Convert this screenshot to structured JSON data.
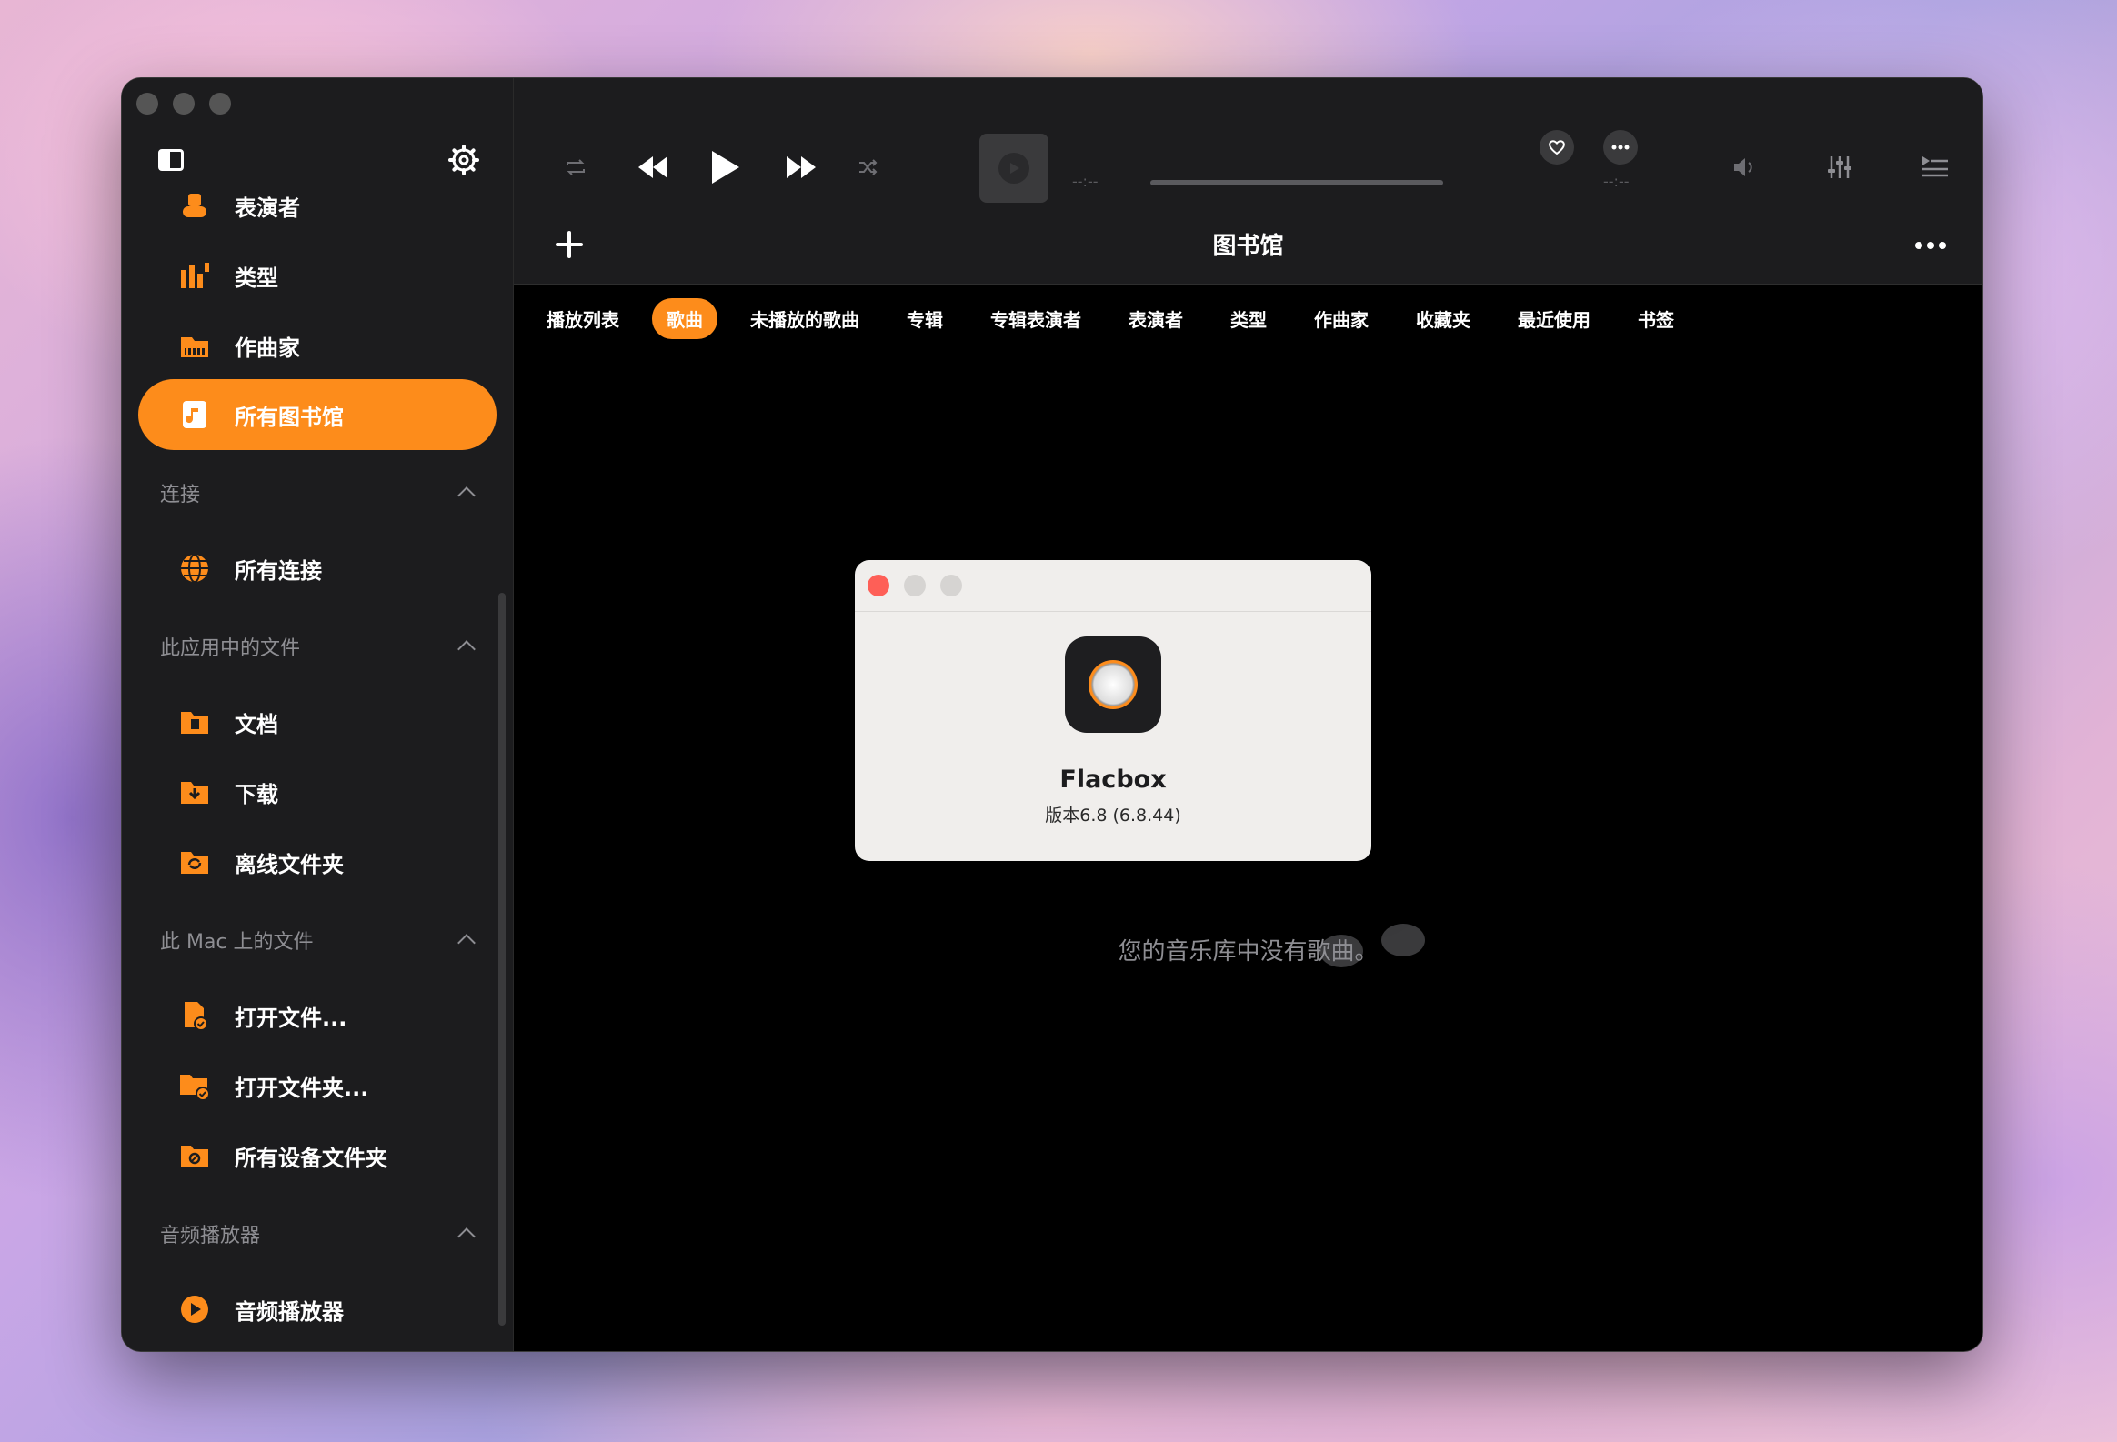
{
  "sidebar": {
    "items_top": [
      {
        "label": "表演者",
        "icon": "performer-icon"
      },
      {
        "label": "类型",
        "icon": "genre-icon"
      },
      {
        "label": "作曲家",
        "icon": "composer-icon"
      },
      {
        "label": "所有图书馆",
        "icon": "library-icon",
        "active": true
      }
    ],
    "sections": {
      "connections": {
        "title": "连接",
        "items": [
          {
            "label": "所有连接",
            "icon": "globe-icon"
          }
        ]
      },
      "app_files": {
        "title": "此应用中的文件",
        "items": [
          {
            "label": "文档",
            "icon": "documents-folder-icon"
          },
          {
            "label": "下载",
            "icon": "downloads-folder-icon"
          },
          {
            "label": "离线文件夹",
            "icon": "offline-folder-icon"
          }
        ]
      },
      "mac_files": {
        "title": "此 Mac 上的文件",
        "items": [
          {
            "label": "打开文件...",
            "icon": "open-file-icon"
          },
          {
            "label": "打开文件夹...",
            "icon": "open-folder-icon"
          },
          {
            "label": "所有设备文件夹",
            "icon": "device-folder-icon"
          }
        ]
      },
      "audio_player": {
        "title": "音频播放器",
        "items": [
          {
            "label": "音频播放器",
            "icon": "play-circle-icon"
          }
        ]
      }
    }
  },
  "player": {
    "elapsed": "--:--",
    "remaining": "--:--"
  },
  "library": {
    "title": "图书馆",
    "tabs": [
      "播放列表",
      "歌曲",
      "未播放的歌曲",
      "专辑",
      "专辑表演者",
      "表演者",
      "类型",
      "作曲家",
      "收藏夹",
      "最近使用",
      "书签"
    ],
    "active_tab": "歌曲",
    "empty_message": "您的音乐库中没有歌曲。"
  },
  "about_dialog": {
    "app_name": "Flacbox",
    "version": "版本6.8 (6.8.44)"
  },
  "colors": {
    "accent": "#fd8c1b",
    "sidebar_bg": "#1c1c1e",
    "close_red": "#fe5f57"
  }
}
